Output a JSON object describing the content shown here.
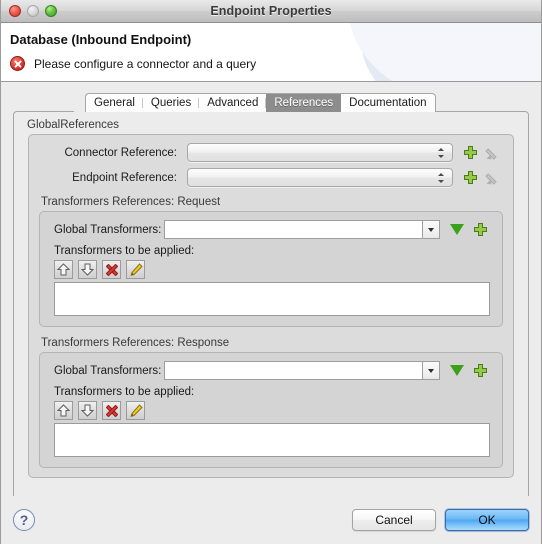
{
  "window": {
    "title": "Endpoint Properties",
    "traffic_lights": [
      {
        "name": "close",
        "color": "#ec5f52"
      },
      {
        "name": "minimize",
        "color": "#dcdcdc"
      },
      {
        "name": "zoom",
        "color": "#66c346"
      }
    ]
  },
  "header": {
    "title": "Database (Inbound Endpoint)",
    "status_icon": "error-icon",
    "status_message": "Please configure a connector and a query",
    "status_color": "#da3b32"
  },
  "tabs": [
    {
      "label": "General",
      "selected": false
    },
    {
      "label": "Queries",
      "selected": false
    },
    {
      "label": "Advanced",
      "selected": false
    },
    {
      "label": "References",
      "selected": true
    },
    {
      "label": "Documentation",
      "selected": false
    }
  ],
  "global_references": {
    "legend": "GlobalReferences",
    "fields": [
      {
        "label": "Connector Reference:",
        "value": "",
        "control": "popup-button",
        "add_button": "plus-icon",
        "edit_button": "pencil-icon",
        "edit_enabled": false
      },
      {
        "label": "Endpoint Reference:",
        "value": "",
        "control": "popup-button",
        "add_button": "plus-icon",
        "edit_button": "pencil-icon",
        "edit_enabled": false
      }
    ]
  },
  "transformer_sections": [
    {
      "legend": "Transformers References: Request",
      "combo_label": "Global Transformers:",
      "combo_value": "",
      "combo_icon": "chevron-down-icon",
      "add_to_list_icon": "triangle-down-icon",
      "create_new_icon": "plus-icon",
      "list_label": "Transformers to be applied:",
      "toolbar": [
        {
          "name": "move-up-button",
          "icon": "arrow-up-icon"
        },
        {
          "name": "move-down-button",
          "icon": "arrow-down-icon"
        },
        {
          "name": "delete-button",
          "icon": "red-x-icon"
        },
        {
          "name": "edit-button",
          "icon": "pencil-icon"
        }
      ],
      "list_items": []
    },
    {
      "legend": "Transformers References: Response",
      "combo_label": "Global Transformers:",
      "combo_value": "",
      "combo_icon": "chevron-down-icon",
      "add_to_list_icon": "triangle-down-icon",
      "create_new_icon": "plus-icon",
      "list_label": "Transformers to be applied:",
      "toolbar": [
        {
          "name": "move-up-button",
          "icon": "arrow-up-icon"
        },
        {
          "name": "move-down-button",
          "icon": "arrow-down-icon"
        },
        {
          "name": "delete-button",
          "icon": "red-x-icon"
        },
        {
          "name": "edit-button",
          "icon": "pencil-icon"
        }
      ],
      "list_items": []
    }
  ],
  "footer": {
    "help_label": "?",
    "cancel_label": "Cancel",
    "ok_label": "OK",
    "default_button": "OK",
    "default_button_color": "#4ea7f3"
  }
}
